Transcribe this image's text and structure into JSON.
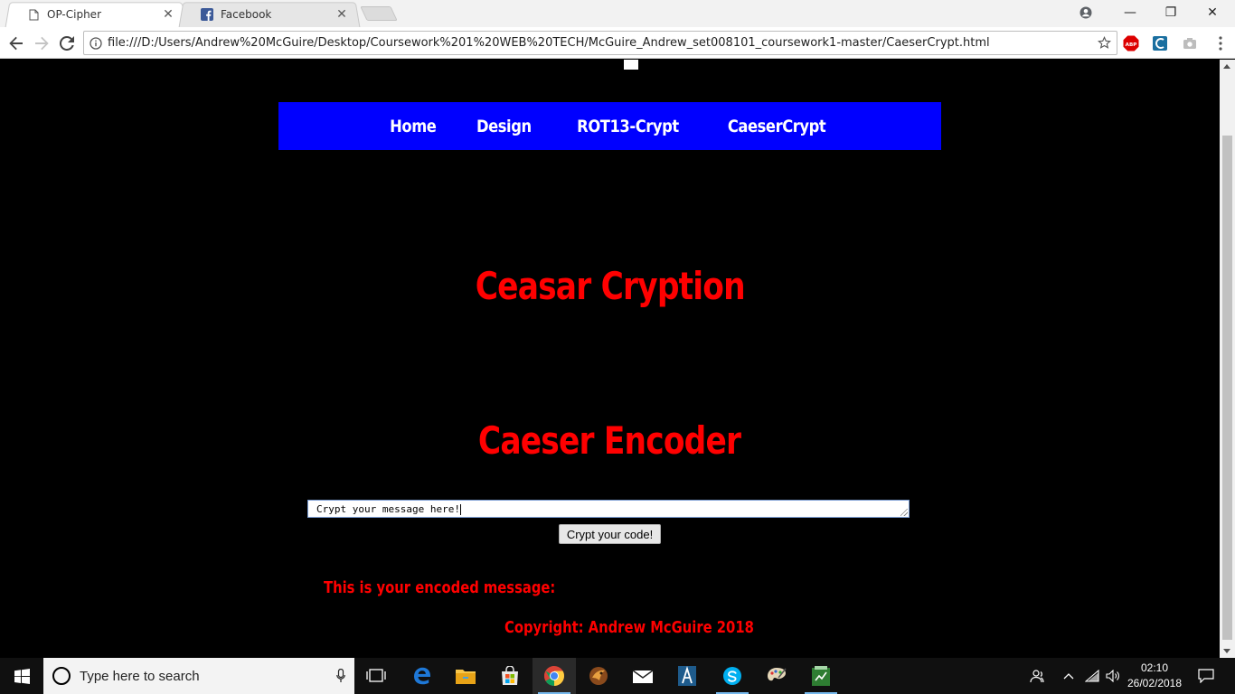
{
  "tabs": [
    {
      "title": "OP-Cipher",
      "icon": "page-icon",
      "close": "✕"
    },
    {
      "title": "Facebook",
      "icon": "facebook-icon",
      "close": "✕"
    }
  ],
  "window_controls": {
    "minimize": "—",
    "restore": "❐",
    "close": "✕"
  },
  "address_bar": {
    "url": "file:///D:/Users/Andrew%20McGuire/Desktop/Coursework%201%20WEB%20TECH/McGuire_Andrew_set008101_coursework1-master/CaeserCrypt.html"
  },
  "extensions": {
    "abp_label": "ABP"
  },
  "page": {
    "nav": [
      "Home",
      "Design",
      "ROT13-Crypt",
      "CaeserCrypt"
    ],
    "heading_main": "Ceasar Cryption",
    "heading_encoder": "Caeser Encoder",
    "input_value": "Crypt your message here!",
    "button_label": "Crypt your code!",
    "result_label": "This is your encoded message:",
    "copyright": "Copyright: Andrew McGuire 2018"
  },
  "taskbar": {
    "search_placeholder": "Type here to search",
    "time": "02:10",
    "date": "26/02/2018"
  },
  "colors": {
    "nav_bg": "#0000ff",
    "heading": "#ff0000",
    "page_bg": "#000000"
  }
}
